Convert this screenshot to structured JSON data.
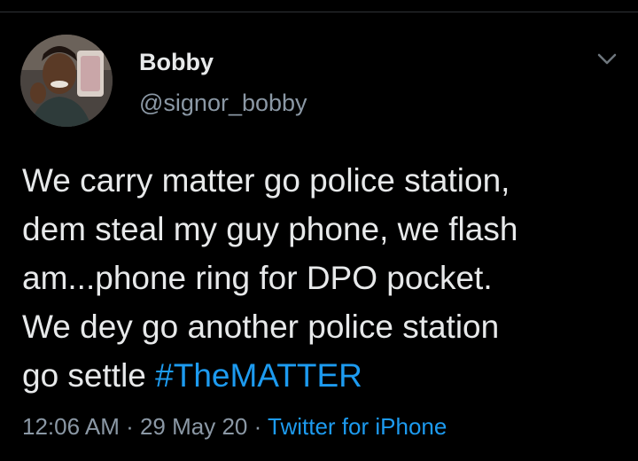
{
  "author": {
    "display_name": "Bobby",
    "handle": "@signor_bobby"
  },
  "tweet": {
    "lines": [
      "We carry matter go police station,",
      "dem steal my guy phone, we flash",
      "am...phone ring for DPO pocket.",
      "We dey go another police station",
      "go settle "
    ],
    "hashtag": "#TheMATTER"
  },
  "meta": {
    "time": "12:06 AM",
    "separator": " · ",
    "date": "29 May 20",
    "source": "Twitter for iPhone"
  },
  "colors": {
    "background": "#000000",
    "text": "#e7e9ea",
    "secondary": "#8b98a5",
    "link": "#1d9bf0"
  },
  "icons": {
    "more": "chevron-down-icon",
    "avatar": "profile-photo"
  }
}
